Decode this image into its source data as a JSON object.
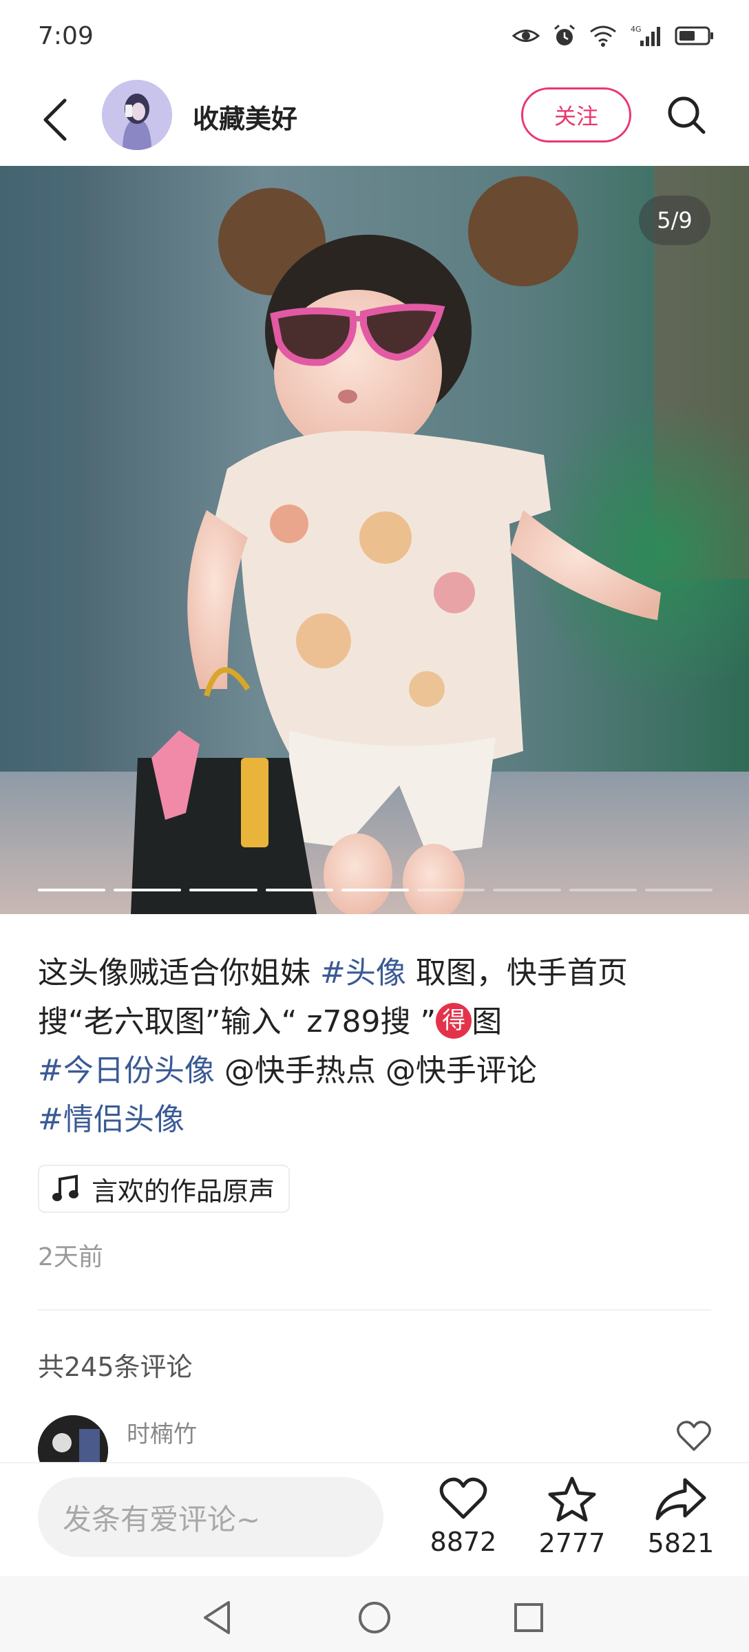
{
  "status_bar": {
    "time": "7:09",
    "icons": [
      "eye-icon",
      "alarm-icon",
      "wifi-icon",
      "signal-4g-icon",
      "battery-icon"
    ],
    "network_label": "4G"
  },
  "header": {
    "account_name": "收藏美好",
    "follow_label": "关注",
    "back_icon": "back-arrow-icon",
    "search_icon": "search-icon"
  },
  "gallery": {
    "page_indicator": "5/9",
    "current_index": 5,
    "total": 9
  },
  "caption": {
    "line1_text": "这头像贼适合你姐妹 ",
    "tag_avatar": "#头像",
    "line1_rest": " 取图，快手首页",
    "line2_a": "搜“老六取图”输入“ z789搜 ”",
    "line2_badge": "得",
    "line2_b": "图",
    "tag_today": "#今日份头像",
    "mention_hot": " @快手热点",
    "mention_comment": " @快手评论",
    "tag_couple": "#情侣头像"
  },
  "music": {
    "icon": "music-note-icon",
    "label": "言欢的作品原声"
  },
  "post_time": "2天前",
  "comments": {
    "count_label": "共245条评论",
    "first_user": "时楠竹"
  },
  "action_bar": {
    "input_placeholder": "发条有爱评论~",
    "likes": "8872",
    "favorites": "2777",
    "shares": "5821"
  },
  "colors": {
    "accent": "#e8386e",
    "tag": "#3a5a95",
    "muted": "#999999"
  }
}
